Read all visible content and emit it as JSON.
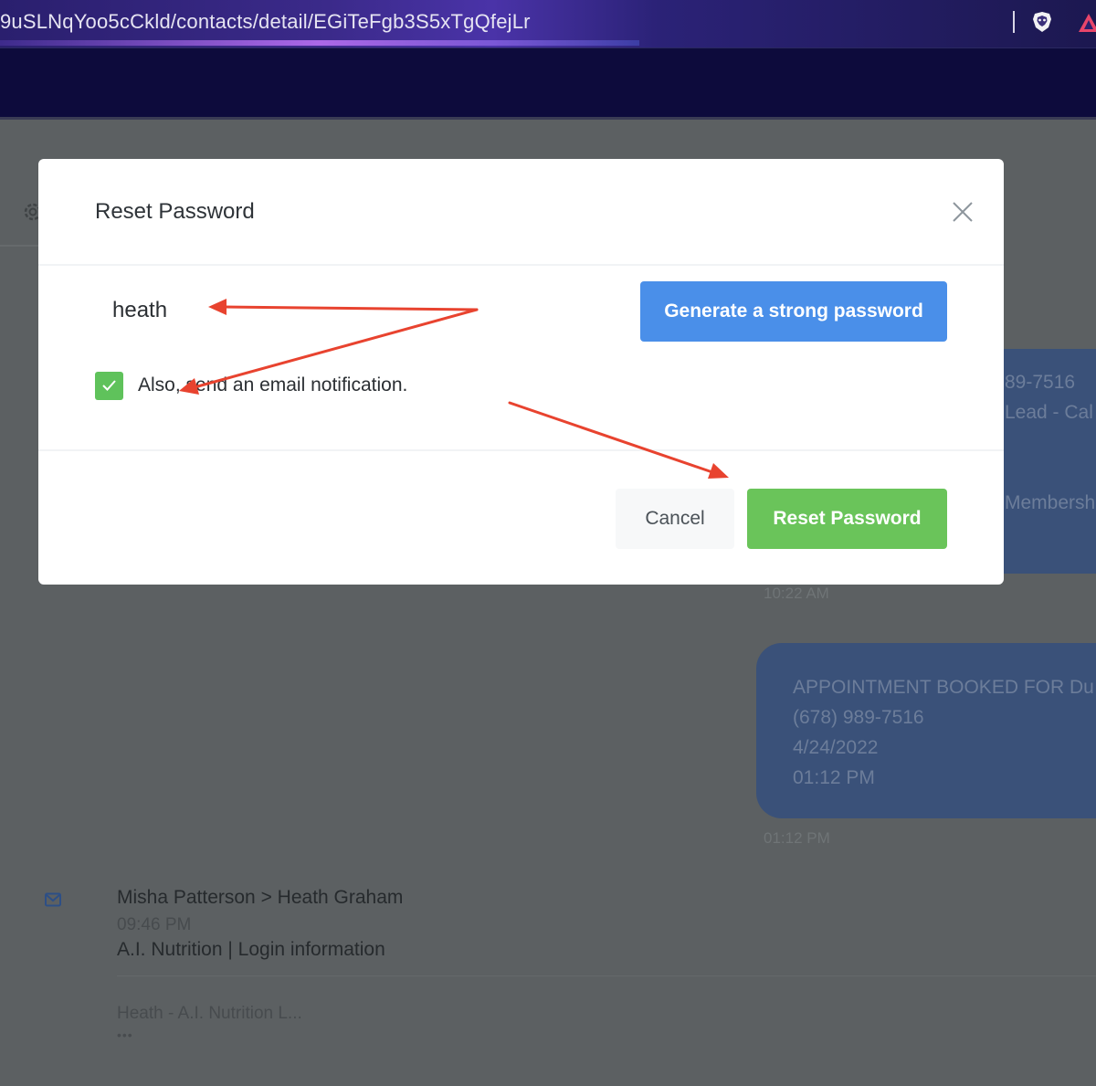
{
  "browser": {
    "url": "9uSLNqYoo5cCkld/contacts/detail/EGiTeFgb3S5xTgQfejLr"
  },
  "background": {
    "bubble1_lines": [
      "89-7516",
      "Lead - Cal",
      "",
      "",
      "Membershi"
    ],
    "bubble1_time": "10:22 AM",
    "bubble2_lines": [
      "APPOINTMENT BOOKED FOR Du",
      "(678) 989-7516",
      "4/24/2022",
      "01:12 PM"
    ],
    "bubble2_time": "01:12 PM",
    "email": {
      "from": "Misha Patterson > Heath Graham",
      "time": "09:46 PM",
      "subject": "A.I. Nutrition | Login information",
      "preview": "Heath - A.I. Nutrition L...",
      "more": "•••"
    }
  },
  "modal": {
    "title": "Reset Password",
    "password_value": "heath",
    "generate_label": "Generate a strong password",
    "checkbox_label": "Also, send an email notification.",
    "checkbox_checked": true,
    "cancel_label": "Cancel",
    "reset_label": "Reset Password"
  },
  "colors": {
    "primary_blue": "#4a8fe9",
    "success_green": "#6ac45a",
    "annotation_red": "#e8432f"
  }
}
